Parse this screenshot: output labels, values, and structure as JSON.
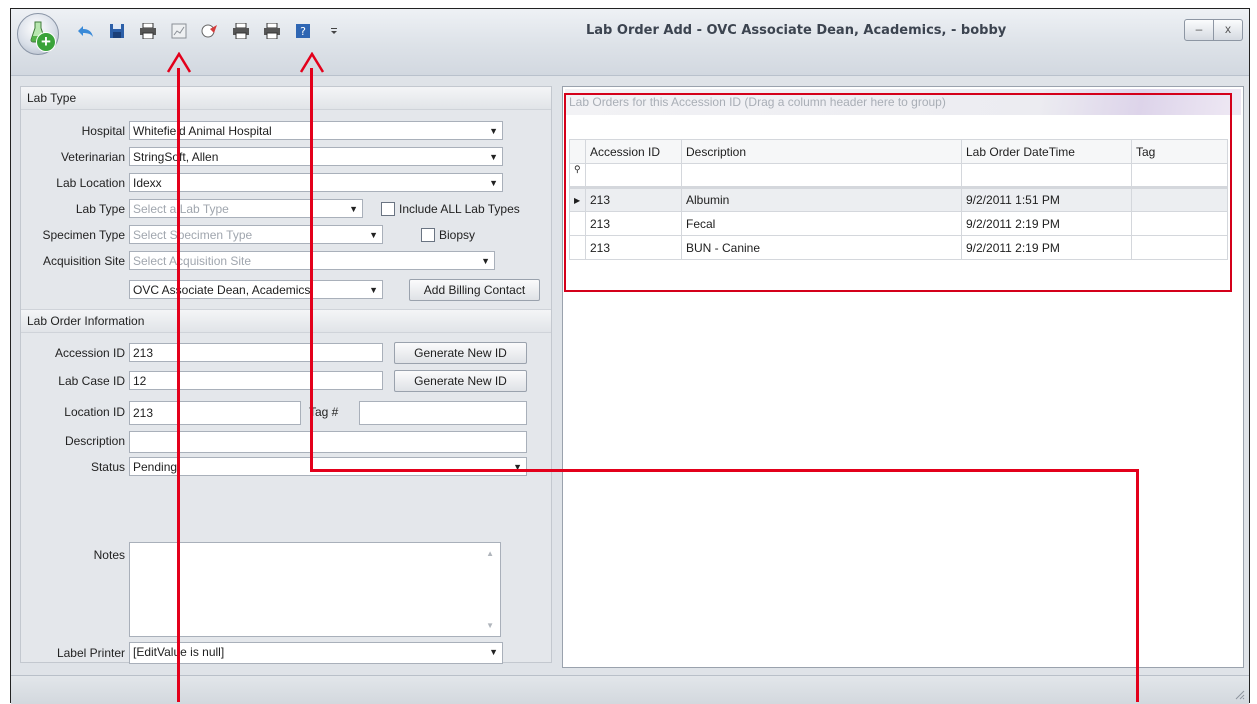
{
  "window": {
    "title": "Lab Order Add - OVC Associate Dean, Academics,  - bobby",
    "min_label": "–",
    "close_label": "x"
  },
  "toolbar": {
    "icons": [
      "undo-icon",
      "save-icon",
      "print-icon",
      "report-icon",
      "send-icon",
      "print-icon-2",
      "print-icon-3",
      "help-icon",
      "customize-icon"
    ]
  },
  "lab_type_group": {
    "header": "Lab Type",
    "hospital": {
      "label": "Hospital",
      "value": "Whitefield Animal Hospital"
    },
    "veterinarian": {
      "label": "Veterinarian",
      "value": "StringSoft, Allen"
    },
    "lab_location": {
      "label": "Lab Location",
      "value": "Idexx"
    },
    "lab_type": {
      "label": "Lab Type",
      "placeholder": "Select a Lab Type"
    },
    "include_all": "Include ALL Lab Types",
    "specimen_type": {
      "label": "Specimen Type",
      "placeholder": "Select Specimen Type"
    },
    "biopsy": "Biopsy",
    "acquisition_site": {
      "label": "Acquisition Site",
      "placeholder": "Select Acquisition Site"
    },
    "billing_contact": "OVC Associate Dean, Academics,",
    "add_billing_button": "Add Billing Contact"
  },
  "lab_order_group": {
    "header": "Lab Order Information",
    "accession_id": {
      "label": "Accession ID",
      "value": "213"
    },
    "lab_case_id": {
      "label": "Lab Case ID",
      "value": "12"
    },
    "location_id": {
      "label": "Location ID",
      "value": "213"
    },
    "tag": {
      "label": "Tag #",
      "value": ""
    },
    "description": {
      "label": "Description",
      "value": ""
    },
    "status": {
      "label": "Status",
      "value": "Pending"
    },
    "notes": {
      "label": "Notes",
      "value": ""
    },
    "label_printer": {
      "label": "Label Printer",
      "value": "[EditValue is null]"
    },
    "generate_button": "Generate New ID"
  },
  "grid": {
    "group_panel": "Lab Orders for this Accession ID  (Drag a column header here to group)",
    "columns": [
      "Accession ID",
      "Description",
      "Lab Order DateTime",
      "Tag"
    ],
    "rows": [
      [
        "213",
        "Albumin",
        "9/2/2011 1:51 PM",
        ""
      ],
      [
        "213",
        "Fecal",
        "9/2/2011 2:19 PM",
        ""
      ],
      [
        "213",
        "BUN - Canine",
        "9/2/2011 2:19 PM",
        ""
      ]
    ]
  },
  "colors": {
    "annotation_red": "#e3001b",
    "accent_green": "#3aa33a"
  }
}
